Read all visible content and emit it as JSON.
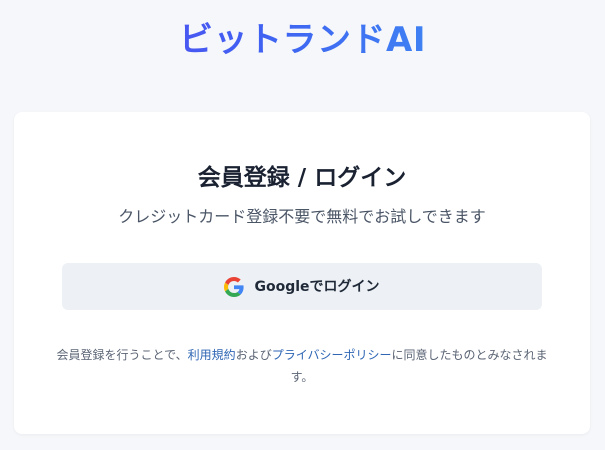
{
  "brand": {
    "name": "ビットランドAI",
    "gradient_colors": [
      "#5a3ff0",
      "#3f63f2",
      "#3fa3f5"
    ]
  },
  "card": {
    "title": "会員登録 / ログイン",
    "subtitle": "クレジットカード登録不要で無料でお試しできます",
    "google_button": {
      "icon": "google-icon",
      "label": "Googleでログイン"
    },
    "note": {
      "prefix": "会員登録を行うことで、",
      "terms_link": "利用規約",
      "middle": "および",
      "privacy_link": "プライバシーポリシー",
      "suffix": "に同意したものとみなされます。"
    }
  },
  "colors": {
    "background": "#f5f7fa",
    "card": "#ffffff",
    "button": "#edf1f5",
    "link": "#2f66b4"
  }
}
